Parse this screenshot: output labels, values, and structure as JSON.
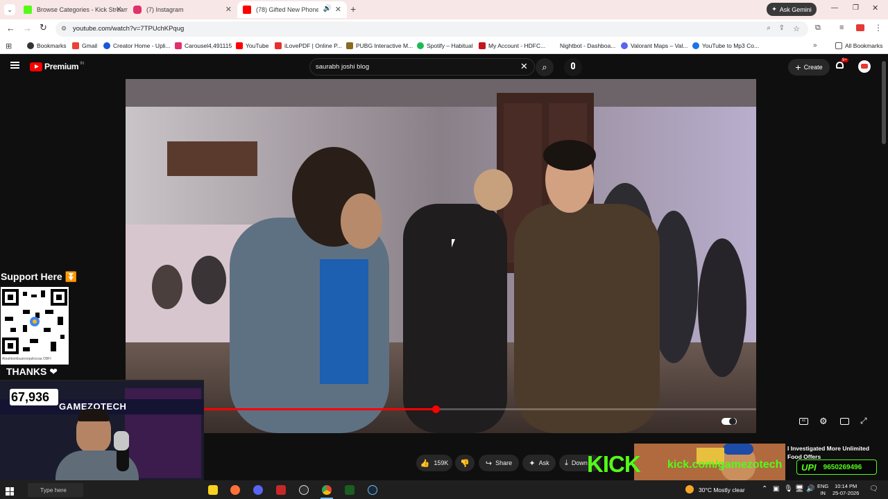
{
  "browser": {
    "tabs": [
      {
        "title": "Browse Categories - Kick Stream",
        "color": "#53fc18"
      },
      {
        "title": "(7) Instagram",
        "color": "#e1306c"
      },
      {
        "title": "(78) Gifted New Phone To A",
        "color": "#ff0000"
      }
    ],
    "new_tab": "+",
    "ask_gemini": "Ask Gemini",
    "url": "youtube.com/watch?v=7TPUchKPqug",
    "bookmarks": [
      {
        "label": "Bookmarks",
        "color": "#333333"
      },
      {
        "label": "Gmail",
        "color": "#ea4335"
      },
      {
        "label": "Creator Home - Upli...",
        "color": "#1a56db"
      },
      {
        "label": "Carousel4,491115",
        "color": "#e1306c"
      },
      {
        "label": "YouTube",
        "color": "#ff0000"
      },
      {
        "label": "iLovePDF | Online P...",
        "color": "#e5322d"
      },
      {
        "label": "PUBG Interactive M...",
        "color": "#8a6a20"
      },
      {
        "label": "Spotify – Habitual",
        "color": "#1db954"
      },
      {
        "label": "My Account - HDFC...",
        "color": "#c4161c"
      },
      {
        "label": "Nightbot - Dashboa...",
        "color": "#555555"
      },
      {
        "label": "Valorant Maps – Val...",
        "color": "#5865f2"
      },
      {
        "label": "YouTube to Mp3 Co...",
        "color": "#1a73e8"
      }
    ],
    "all_bookmarks": "All Bookmarks"
  },
  "youtube": {
    "logo_text": "Premium",
    "logo_region": "IN",
    "search_value": "saurabh joshi blog",
    "create_label": "Create",
    "notif_count": "9+",
    "actions": {
      "likes": "159K",
      "share": "Share",
      "ask": "Ask",
      "download": "Down"
    },
    "progress_fraction": 0.42,
    "recommended": {
      "title": "I Investigated More Unlimited Food Offers"
    }
  },
  "overlay": {
    "support_here": "Support Here",
    "thanks": "THANKS",
    "counter": "67,936",
    "channel_name": "GAMEZOTECH",
    "kick_brand": "KICK",
    "kick_url": "kick.com/gamezotech",
    "upi_label": "UPI",
    "upi_number": "9650269496",
    "qr_caption": "Aloahtsekbuanorqaikocaa OBFI"
  },
  "taskbar": {
    "search_placeholder": "Type here",
    "weather": "30°C  Mostly clear",
    "lang1": "ENG",
    "lang2": "IN",
    "time": "10:14 PM",
    "date": "25-07-2026"
  }
}
